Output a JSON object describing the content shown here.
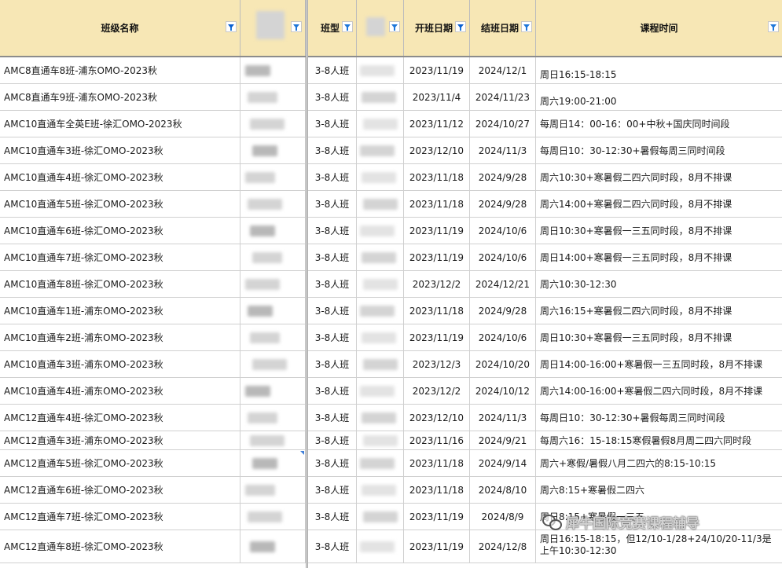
{
  "headers": {
    "name": "班级名称",
    "type": "班型",
    "start": "开班日期",
    "end": "结班日期",
    "time": "课程时间"
  },
  "rows": [
    {
      "name": "AMC8直通车8班-浦东OMO-2023秋",
      "type": "3-8人班",
      "start": "2023/11/19",
      "end": "2024/12/1",
      "time": "周日16:15-18:15"
    },
    {
      "name": "AMC8直通车9班-浦东OMO-2023秋",
      "type": "3-8人班",
      "start": "2023/11/4",
      "end": "2024/11/23",
      "time": "周六19:00-21:00"
    },
    {
      "name": "AMC10直通车全英E班-徐汇OMO-2023秋",
      "type": "3-8人班",
      "start": "2023/11/12",
      "end": "2024/10/27",
      "time": "每周日14：00-16：00+中秋+国庆同时间段"
    },
    {
      "name": "AMC10直通车3班-徐汇OMO-2023秋",
      "type": "3-8人班",
      "start": "2023/12/10",
      "end": "2024/11/3",
      "time": "每周日10：30-12:30+暑假每周三同时间段"
    },
    {
      "name": "AMC10直通车4班-徐汇OMO-2023秋",
      "type": "3-8人班",
      "start": "2023/11/18",
      "end": "2024/9/28",
      "time": "周六10:30+寒暑假二四六同时段，8月不排课"
    },
    {
      "name": "AMC10直通车5班-徐汇OMO-2023秋",
      "type": "3-8人班",
      "start": "2023/11/18",
      "end": "2024/9/28",
      "time": "周六14:00+寒暑假二四六同时段，8月不排课"
    },
    {
      "name": "AMC10直通车6班-徐汇OMO-2023秋",
      "type": "3-8人班",
      "start": "2023/11/19",
      "end": "2024/10/6",
      "time": "周日10:30+寒暑假一三五同时段，8月不排课"
    },
    {
      "name": "AMC10直通车7班-徐汇OMO-2023秋",
      "type": "3-8人班",
      "start": "2023/11/19",
      "end": "2024/10/6",
      "time": "周日14:00+寒暑假一三五同时段，8月不排课"
    },
    {
      "name": "AMC10直通车8班-徐汇OMO-2023秋",
      "type": "3-8人班",
      "start": "2023/12/2",
      "end": "2024/12/21",
      "time": "周六10:30-12:30"
    },
    {
      "name": "AMC10直通车1班-浦东OMO-2023秋",
      "type": "3-8人班",
      "start": "2023/11/18",
      "end": "2024/9/28",
      "time": "周六16:15+寒暑假二四六同时段，8月不排课"
    },
    {
      "name": "AMC10直通车2班-浦东OMO-2023秋",
      "type": "3-8人班",
      "start": "2023/11/19",
      "end": "2024/10/6",
      "time": "周日10:30+寒暑假一三五同时段，8月不排课"
    },
    {
      "name": "AMC10直通车3班-浦东OMO-2023秋",
      "type": "3-8人班",
      "start": "2023/12/3",
      "end": "2024/10/20",
      "time": "周日14:00-16:00+寒暑假一三五同时段，8月不排课"
    },
    {
      "name": "AMC10直通车4班-浦东OMO-2023秋",
      "type": "3-8人班",
      "start": "2023/12/2",
      "end": "2024/10/12",
      "time": "周六14:00-16:00+寒暑假二四六同时段，8月不排课"
    },
    {
      "name": "AMC12直通车4班-徐汇OMO-2023秋",
      "type": "3-8人班",
      "start": "2023/12/10",
      "end": "2024/11/3",
      "time": "每周日10：30-12:30+暑假每周三同时间段"
    },
    {
      "name": "AMC12直通车3班-浦东OMO-2023秋",
      "type": "3-8人班",
      "start": "2023/11/16",
      "end": "2024/9/21",
      "time": "每周六16：15-18:15寒假暑假8月周二四六同时段"
    },
    {
      "name": "AMC12直通车5班-徐汇OMO-2023秋",
      "type": "3-8人班",
      "start": "2023/11/18",
      "end": "2024/9/14",
      "time": "周六+寒假/暑假八月二四六的8:15-10:15"
    },
    {
      "name": "AMC12直通车6班-徐汇OMO-2023秋",
      "type": "3-8人班",
      "start": "2023/11/18",
      "end": "2024/8/10",
      "time": "周六8:15+寒暑假二四六"
    },
    {
      "name": "AMC12直通车7班-徐汇OMO-2023秋",
      "type": "3-8人班",
      "start": "2023/11/19",
      "end": "2024/8/9",
      "time": "周日8:15+寒暑假一三五"
    },
    {
      "name": "AMC12直通车8班-徐汇OMO-2023秋",
      "type": "3-8人班",
      "start": "2023/11/19",
      "end": "2024/12/8",
      "time": "周日16:15-18:15，但12/10-1/28+24/10/20-11/3是上午10:30-12:30"
    }
  ],
  "watermark": {
    "text": "犀牛国际竞赛课程辅导",
    "icon": "wechat-icon"
  },
  "colors": {
    "header_bg": "#f7e7b5",
    "filter_icon": "#1f77d9"
  }
}
